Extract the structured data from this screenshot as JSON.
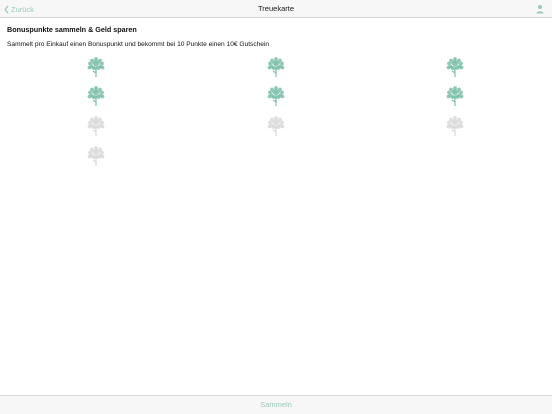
{
  "navbar": {
    "back_label": "Zurück",
    "title": "Treuekarte",
    "profile_icon": "person-icon"
  },
  "card": {
    "heading": "Bonuspunkte sammeln & Geld sparen",
    "description": "Sammelt pro Einkauf einen Bonuspunkt und bekommt bei 10 Punkte einen 10€ Gutschein",
    "total_stamps": 10,
    "collected_stamps": 6,
    "stamp_icon": "tree-icon"
  },
  "footer": {
    "collect_label": "Sammeln"
  },
  "colors": {
    "accent": "#9cc9b9",
    "stamp_active": "#7cbfa9",
    "stamp_inactive": "#d9d9d9"
  }
}
